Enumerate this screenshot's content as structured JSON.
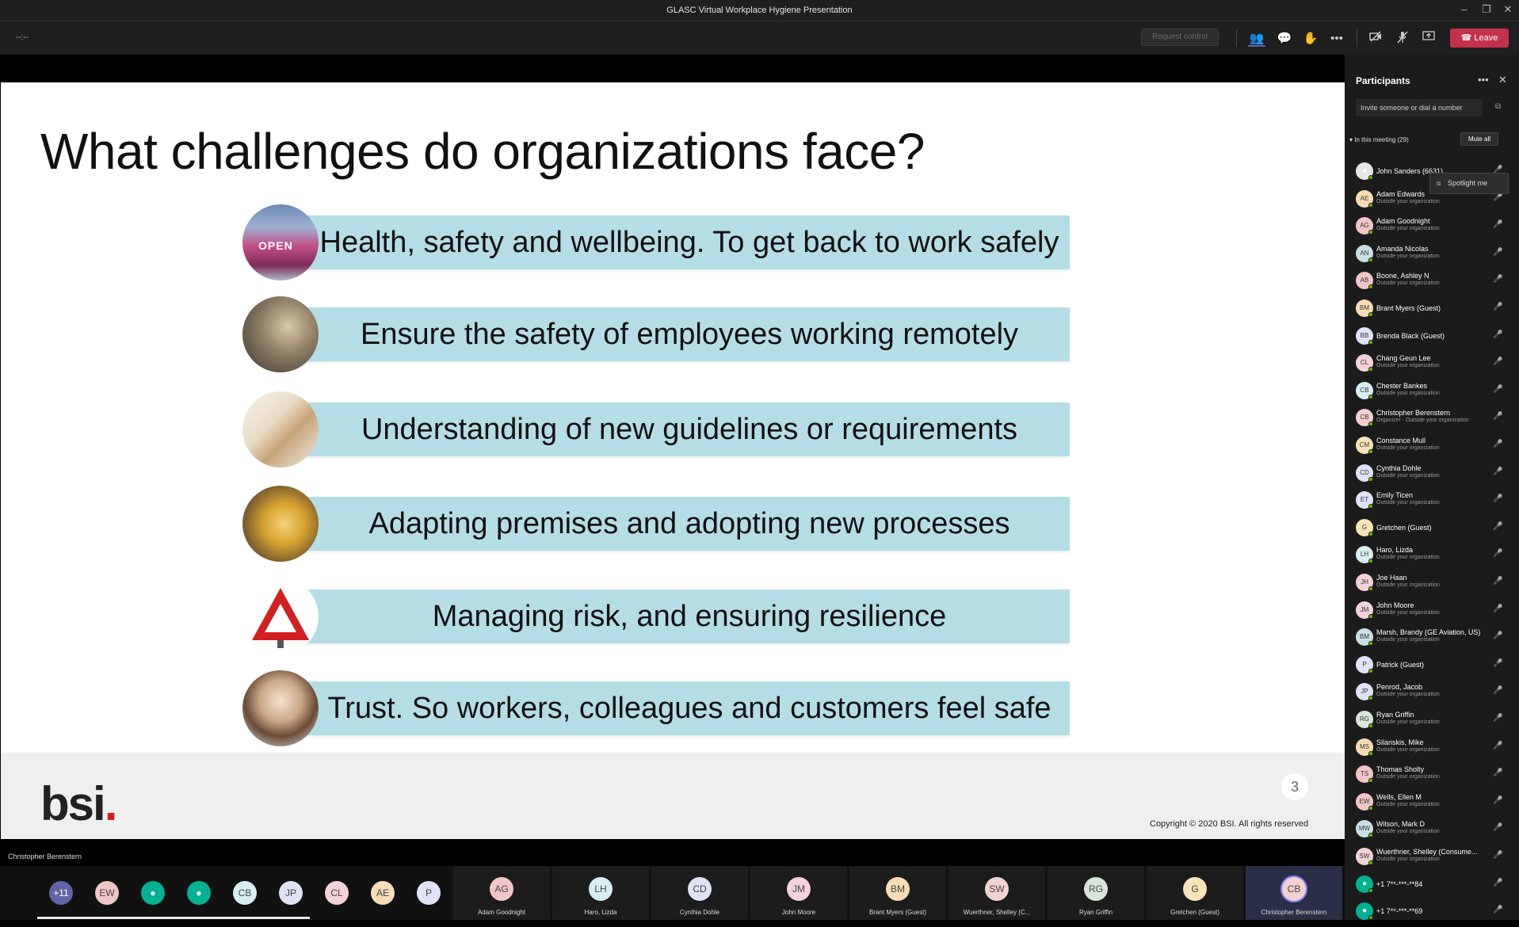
{
  "window": {
    "title": "GLASC Virtual Workplace Hygiene Presentation"
  },
  "toolbar": {
    "timer": "--:--",
    "request_control": "Request control",
    "leave_label": "Leave"
  },
  "slide": {
    "title": "What challenges do organizations face?",
    "items": [
      "Health, safety and wellbeing. To get back to work safely",
      "Ensure the safety of employees working remotely",
      "Understanding of new guidelines or requirements",
      "Adapting premises and adopting new processes",
      "Managing risk, and ensuring resilience",
      "Trust. So workers, colleagues and customers feel safe"
    ],
    "open_sign": "OPEN",
    "logo": "bsi",
    "page_number": "3",
    "copyright": "Copyright © 2020 BSI. All rights reserved"
  },
  "presenter_name": "Christopher Berenstern",
  "bottom_avatars": [
    "+11",
    "EW",
    "",
    "",
    "CB",
    "JP",
    "CL",
    "AE",
    "P"
  ],
  "video_tiles": [
    {
      "initials": "AG",
      "name": "Adam Goodnight",
      "color": "#f0c6c6"
    },
    {
      "initials": "LH",
      "name": "Haro, Lizda",
      "color": "#d7eef2"
    },
    {
      "initials": "CD",
      "name": "Cynthia Dohle",
      "color": "#dfe3f5"
    },
    {
      "initials": "JM",
      "name": "John Moore",
      "color": "#f4d2da"
    },
    {
      "initials": "BM",
      "name": "Brant Myers (Guest)",
      "color": "#f9dcb6"
    },
    {
      "initials": "SW",
      "name": "Wuerthner, Shelley (C...",
      "color": "#f0d3d3"
    },
    {
      "initials": "RG",
      "name": "Ryan Griffin",
      "color": "#d8e6da"
    },
    {
      "initials": "G",
      "name": "Gretchen (Guest)",
      "color": "#f9e3b8"
    },
    {
      "initials": "CB",
      "name": "Christopher Berenstern",
      "color": "#f3d0d0"
    }
  ],
  "participants_panel": {
    "title": "Participants",
    "invite_placeholder": "Invite someone or dial a number",
    "in_meeting": "In this meeting (29)",
    "mute_all": "Mute all",
    "spotlight": "Spotlight me",
    "people": [
      {
        "initials": "",
        "name": "John Sanders (6631)",
        "sub": "",
        "color": "#e6e6e6"
      },
      {
        "initials": "AE",
        "name": "Adam Edwards",
        "sub": "Outside your organization",
        "color": "#f9dcb6"
      },
      {
        "initials": "AG",
        "name": "Adam Goodnight",
        "sub": "Outside your organization",
        "color": "#f0c6c6"
      },
      {
        "initials": "AN",
        "name": "Amanda Nicolas",
        "sub": "Outside your organization",
        "color": "#c9e0e4"
      },
      {
        "initials": "AB",
        "name": "Boone, Ashley N",
        "sub": "Outside your organization",
        "color": "#f0c6c6"
      },
      {
        "initials": "BM",
        "name": "Brant Myers (Guest)",
        "sub": "",
        "color": "#f9dcb6"
      },
      {
        "initials": "BB",
        "name": "Brenda Black (Guest)",
        "sub": "",
        "color": "#dfe3f5"
      },
      {
        "initials": "CL",
        "name": "Chang Geun Lee",
        "sub": "Outside your organization",
        "color": "#f4d2da"
      },
      {
        "initials": "CB",
        "name": "Chester Bankes",
        "sub": "Outside your organization",
        "color": "#d7eef2"
      },
      {
        "initials": "CB",
        "name": "Christopher Berenstern",
        "sub": "Organizer · Outside your organization",
        "color": "#f3d0d0"
      },
      {
        "initials": "CM",
        "name": "Constance Mull",
        "sub": "Outside your organization",
        "color": "#f9e3b8"
      },
      {
        "initials": "CD",
        "name": "Cynthia Dohle",
        "sub": "Outside your organization",
        "color": "#dfe3f5"
      },
      {
        "initials": "ET",
        "name": "Emily Ticen",
        "sub": "Outside your organization",
        "color": "#dfe3f5"
      },
      {
        "initials": "G",
        "name": "Gretchen (Guest)",
        "sub": "",
        "color": "#f9e3b8"
      },
      {
        "initials": "LH",
        "name": "Haro, Lizda",
        "sub": "Outside your organization",
        "color": "#d7eef2"
      },
      {
        "initials": "JH",
        "name": "Joe Haan",
        "sub": "Outside your organization",
        "color": "#f4d2da"
      },
      {
        "initials": "JM",
        "name": "John Moore",
        "sub": "Outside your organization",
        "color": "#f4d2da"
      },
      {
        "initials": "BM",
        "name": "Marsh, Brandy (GE Aviation, US)",
        "sub": "Outside your organization",
        "color": "#c9e0e4"
      },
      {
        "initials": "P",
        "name": "Patrick (Guest)",
        "sub": "",
        "color": "#dfe3f5"
      },
      {
        "initials": "JP",
        "name": "Penrod, Jacob",
        "sub": "Outside your organization",
        "color": "#dfe3f5"
      },
      {
        "initials": "RG",
        "name": "Ryan Griffin",
        "sub": "Outside your organization",
        "color": "#d8e6da"
      },
      {
        "initials": "MS",
        "name": "Silanskis, Mike",
        "sub": "Outside your organization",
        "color": "#f9dcb6"
      },
      {
        "initials": "TS",
        "name": "Thomas Sholty",
        "sub": "Outside your organization",
        "color": "#f0c6c6"
      },
      {
        "initials": "EW",
        "name": "Wells, Ellen M",
        "sub": "Outside your organization",
        "color": "#f0c6c6"
      },
      {
        "initials": "MW",
        "name": "Wilson, Mark D",
        "sub": "Outside your organization",
        "color": "#c9e0e4"
      },
      {
        "initials": "SW",
        "name": "Wuerthner, Shelley (Consume...",
        "sub": "Outside your organization",
        "color": "#f0d3d3"
      },
      {
        "initials": "",
        "name": "+1 7**-***-**84",
        "sub": "",
        "color": "#00b294"
      },
      {
        "initials": "",
        "name": "+1 7**-***-**69",
        "sub": "",
        "color": "#00b294"
      }
    ]
  },
  "colors": {
    "leave": "#c4314b",
    "slide_bar": "#b5dde5",
    "bsi_dot": "#d71921"
  }
}
